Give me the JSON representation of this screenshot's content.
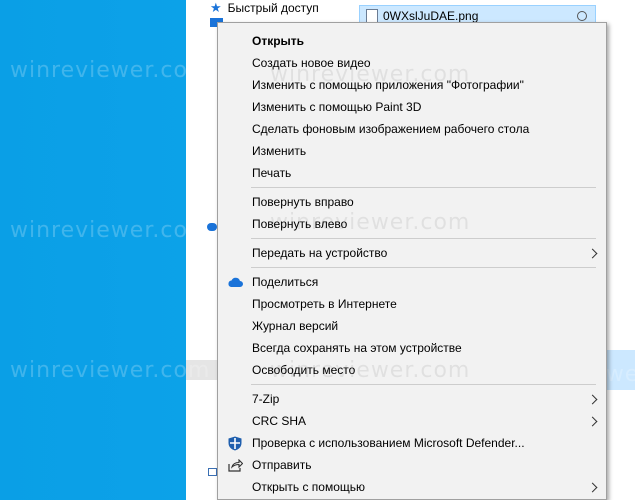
{
  "navigation": {
    "quick_access_label": "Быстрый доступ"
  },
  "file": {
    "name": "0WXslJuDAE.png"
  },
  "context_menu": {
    "open": "Открыть",
    "create_video": "Создать новое видео",
    "edit_with_photos": "Изменить с помощью приложения \"Фотографии\"",
    "edit_with_paint3d": "Изменить с помощью Paint 3D",
    "set_wallpaper": "Сделать фоновым изображением рабочего стола",
    "edit": "Изменить",
    "print": "Печать",
    "rotate_right": "Повернуть вправо",
    "rotate_left": "Повернуть влево",
    "cast_to_device": "Передать на устройство",
    "share": "Поделиться",
    "view_online": "Просмотреть в Интернете",
    "version_history": "Журнал версий",
    "always_keep": "Всегда сохранять на этом устройстве",
    "free_up_space": "Освободить место",
    "seven_zip": "7-Zip",
    "crc_sha": "CRC SHA",
    "defender_scan": "Проверка с использованием Microsoft Defender...",
    "send_to": "Отправить",
    "open_with": "Открыть с помощью"
  },
  "icons": {
    "quick_access": "star-icon",
    "share": "onedrive-cloud-icon",
    "defender": "defender-shield-icon",
    "send_to": "share-arrow-icon"
  },
  "watermark": "winreviewer.com",
  "colors": {
    "desktop": "#0a9fe6",
    "selection": "#cce8ff",
    "menu_bg": "#f2f2f2",
    "onedrive": "#1a73d9"
  }
}
